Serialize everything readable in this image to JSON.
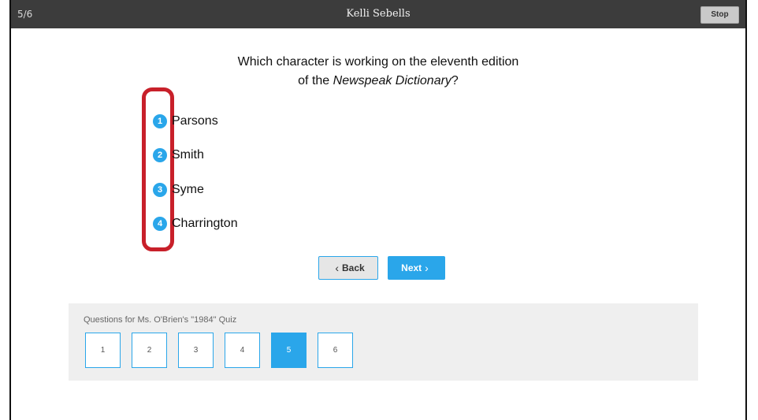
{
  "header": {
    "progress": "5/6",
    "title": "Kelli Sebells",
    "stop_label": "Stop"
  },
  "question": {
    "text_before": "Which character is working on the eleventh edition",
    "text_line2_prefix": "of the ",
    "text_italic": "Newspeak Dictionary",
    "text_suffix": "?"
  },
  "options": [
    {
      "number": "1",
      "label": "Parsons"
    },
    {
      "number": "2",
      "label": "Smith"
    },
    {
      "number": "3",
      "label": "Syme"
    },
    {
      "number": "4",
      "label": "Charrington"
    }
  ],
  "nav": {
    "back_label": "Back",
    "next_label": "Next",
    "back_chevron": "‹",
    "next_chevron": "›"
  },
  "quiz_panel": {
    "title": "Questions for Ms. O'Brien's \"1984\" Quiz",
    "questions": [
      "1",
      "2",
      "3",
      "4",
      "5",
      "6"
    ],
    "active_question": "5"
  },
  "colors": {
    "accent": "#2aa6ea",
    "highlight": "#c8202a",
    "topbar": "#3c3c3c"
  }
}
